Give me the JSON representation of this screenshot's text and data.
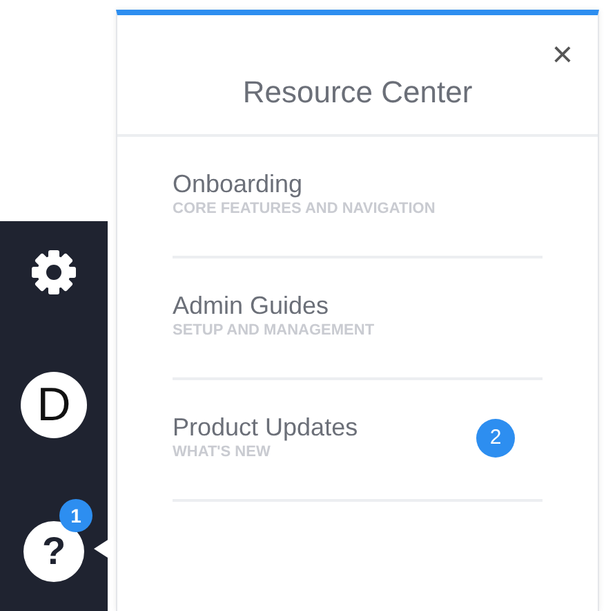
{
  "sidebar": {
    "items": [
      {
        "kind": "settings"
      },
      {
        "kind": "avatar",
        "label": "D"
      },
      {
        "kind": "help",
        "label": "?",
        "badge": "1"
      }
    ]
  },
  "panel": {
    "title": "Resource Center",
    "close": "×",
    "items": [
      {
        "title": "Onboarding",
        "subtitle": "CORE FEATURES AND NAVIGATION"
      },
      {
        "title": "Admin Guides",
        "subtitle": "SETUP AND MANAGEMENT"
      },
      {
        "title": "Product Updates",
        "subtitle": "WHAT'S NEW",
        "badge": "2"
      }
    ]
  }
}
